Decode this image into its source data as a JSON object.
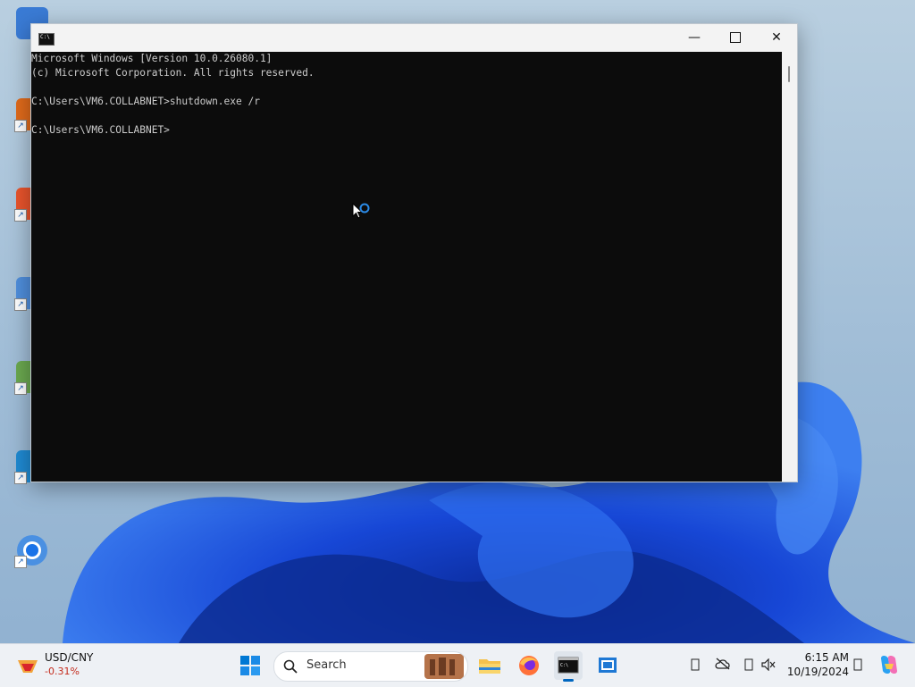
{
  "console": {
    "lines": [
      "Microsoft Windows [Version 10.0.26080.1]",
      "(c) Microsoft Corporation. All rights reserved.",
      "",
      "C:\\Users\\VM6.COLLABNET>shutdown.exe /r",
      "",
      "C:\\Users\\VM6.COLLABNET>"
    ]
  },
  "window": {
    "minimize_glyph": "—",
    "close_glyph": "✕"
  },
  "taskbar": {
    "widget_title": "USD/CNY",
    "widget_change": "-0.31%",
    "search_label": "Search",
    "time": "6:15 AM",
    "date": "10/19/2024"
  },
  "colors": {
    "console_bg": "#0c0c0c",
    "console_text": "#cccccc",
    "accent": "#0067c0",
    "negative": "#c42b1c"
  },
  "icons": {
    "start": "windows-logo-icon",
    "search": "search-icon",
    "explorer": "folder-icon",
    "firefox": "firefox-icon",
    "terminal": "command-prompt-icon",
    "vm": "virtual-machine-icon",
    "copilot": "copilot-icon"
  }
}
